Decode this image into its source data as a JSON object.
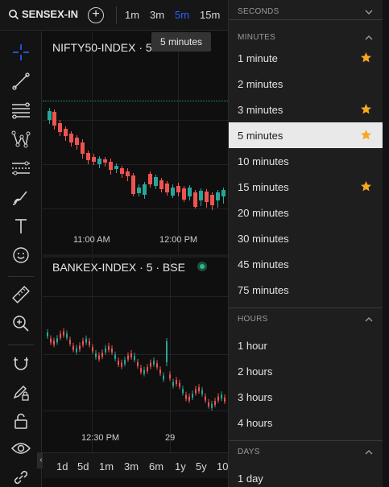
{
  "toolbar": {
    "symbol": "SENSEX-IN",
    "add_symbol": "+",
    "intervals": [
      "1m",
      "3m",
      "5m",
      "15m"
    ],
    "active_interval": "5m"
  },
  "tooltip": "5 minutes",
  "panes": [
    {
      "title": "NIFTY50-INDEX · 5 · N",
      "time_labels": [
        "11:00 AM",
        "12:00 PM"
      ]
    },
    {
      "title": "BANKEX-INDEX · 5 · BSE",
      "time_labels": [
        "12:30 PM",
        "29"
      ]
    }
  ],
  "ranges": [
    "1d",
    "5d",
    "1m",
    "3m",
    "6m",
    "1y",
    "5y",
    "10"
  ],
  "dropdown": {
    "sections": [
      {
        "label": "SECONDS",
        "collapsed": true,
        "items": []
      },
      {
        "label": "MINUTES",
        "collapsed": false,
        "items": [
          {
            "label": "1 minute",
            "favorite": true
          },
          {
            "label": "2 minutes",
            "favorite": false
          },
          {
            "label": "3 minutes",
            "favorite": true
          },
          {
            "label": "5 minutes",
            "favorite": true,
            "selected": true
          },
          {
            "label": "10 minutes",
            "favorite": false
          },
          {
            "label": "15 minutes",
            "favorite": true
          },
          {
            "label": "20 minutes",
            "favorite": false
          },
          {
            "label": "30 minutes",
            "favorite": false
          },
          {
            "label": "45 minutes",
            "favorite": false
          },
          {
            "label": "75 minutes",
            "favorite": false
          }
        ]
      },
      {
        "label": "HOURS",
        "collapsed": false,
        "items": [
          {
            "label": "1 hour",
            "favorite": false
          },
          {
            "label": "2 hours",
            "favorite": false
          },
          {
            "label": "3 hours",
            "favorite": false
          },
          {
            "label": "4 hours",
            "favorite": false
          }
        ]
      },
      {
        "label": "DAYS",
        "collapsed": false,
        "items": [
          {
            "label": "1 day",
            "favorite": false
          }
        ]
      }
    ]
  },
  "colors": {
    "accent": "#2962ff",
    "up": "#26a69a",
    "down": "#ef5350",
    "star": "#f7a722"
  }
}
